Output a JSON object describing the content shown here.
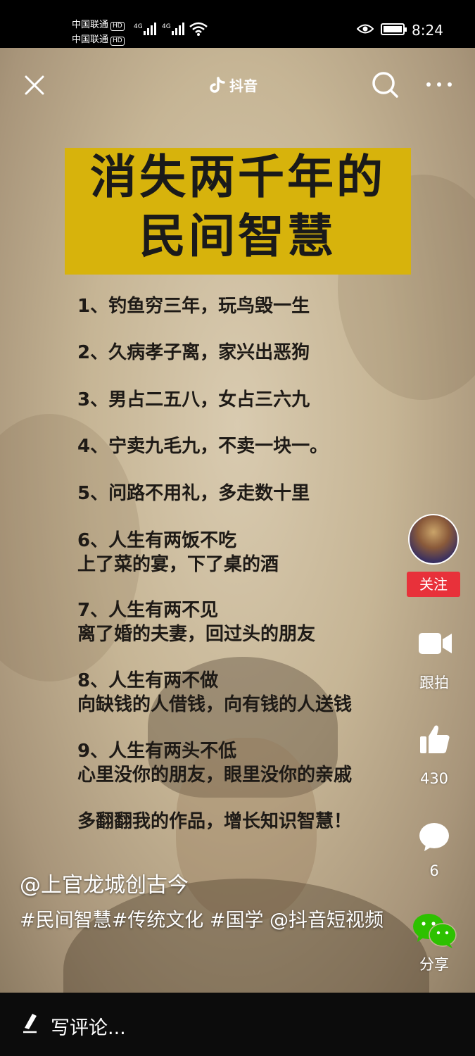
{
  "status_bar": {
    "carrier_1": "中国联通",
    "carrier_2": "中国联通",
    "hd": "HD",
    "net_1": "4G",
    "net_2": "4G",
    "time": "8:24"
  },
  "top_bar": {
    "app_name": "抖音",
    "icons": [
      "close-icon",
      "tiktok-icon",
      "search-icon",
      "more-icon"
    ]
  },
  "content": {
    "title_line_1": "消失两千年的",
    "title_line_2": "民间智慧",
    "items": [
      "1、钓鱼穷三年，玩鸟毁一生",
      "2、久病孝子离，家兴出恶狗",
      "3、男占二五八，女占三六九",
      "4、宁卖九毛九，不卖一块一。",
      "5、问路不用礼，多走数十里",
      "6、人生有两饭不吃",
      "上了菜的宴，下了桌的酒",
      "7、人生有两不见",
      "离了婚的夫妻，回过头的朋友",
      "8、人生有两不做",
      "向缺钱的人借钱，向有钱的人送钱",
      "9、人生有两头不低",
      "心里没你的朋友，眼里没你的亲戚",
      "多翻翻我的作品，增长知识智慧！"
    ]
  },
  "side_rail": {
    "follow_label": "关注",
    "duet_label": "跟拍",
    "like_count": "430",
    "comment_count": "6",
    "share_label": "分享",
    "colors": {
      "follow_bg": "#e8313a",
      "share_green": "#2dc100"
    }
  },
  "post": {
    "author": "@上官龙城创古今",
    "description": "#民间智慧#传统文化 #国学 @抖音短视频"
  },
  "bottom_bar": {
    "comment_placeholder": "写评论..."
  },
  "colors": {
    "title_bg": "#d7b30c"
  }
}
